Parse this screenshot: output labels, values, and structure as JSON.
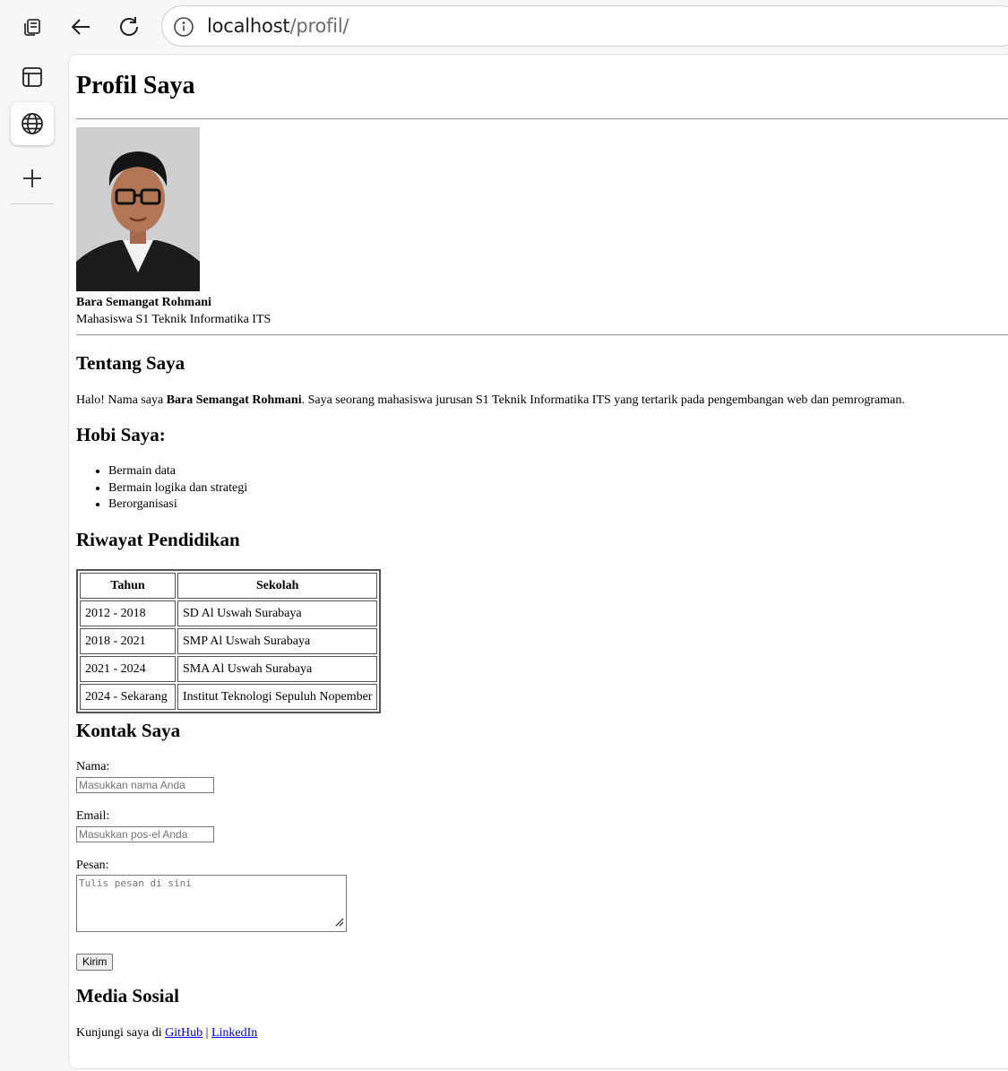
{
  "browser": {
    "url_host": "localhost",
    "url_path": "/profil/"
  },
  "page": {
    "title": "Profil Saya",
    "profile": {
      "name": "Bara Semangat Rohmani",
      "role": "Mahasiswa S1 Teknik Informatika ITS"
    },
    "about": {
      "heading": "Tentang Saya",
      "text_before": "Halo! Nama saya ",
      "name_bold": "Bara Semangat Rohmani",
      "text_after": ". Saya seorang mahasiswa jurusan S1 Teknik Informatika ITS yang tertarik pada pengembangan web dan pemrograman."
    },
    "hobbies": {
      "heading": "Hobi Saya:",
      "items": [
        "Bermain data",
        "Bermain logika dan strategi",
        "Berorganisasi"
      ]
    },
    "education": {
      "heading": "Riwayat Pendidikan",
      "columns": [
        "Tahun",
        "Sekolah"
      ],
      "rows": [
        [
          "2012 - 2018",
          "SD Al Uswah Surabaya"
        ],
        [
          "2018 - 2021",
          "SMP Al Uswah Surabaya"
        ],
        [
          "2021 - 2024",
          "SMA Al Uswah Surabaya"
        ],
        [
          "2024 - Sekarang",
          "Institut Teknologi Sepuluh Nopember"
        ]
      ]
    },
    "contact": {
      "heading": "Kontak Saya",
      "name_label": "Nama:",
      "name_placeholder": "Masukkan nama Anda",
      "email_label": "Email:",
      "email_placeholder": "Masukkan pos-el Anda",
      "message_label": "Pesan:",
      "message_placeholder": "Tulis pesan di sini",
      "submit_label": "Kirim"
    },
    "social": {
      "heading": "Media Sosial",
      "prefix": "Kunjungi saya di ",
      "github": "GitHub",
      "separator": " | ",
      "linkedin": "LinkedIn"
    }
  }
}
